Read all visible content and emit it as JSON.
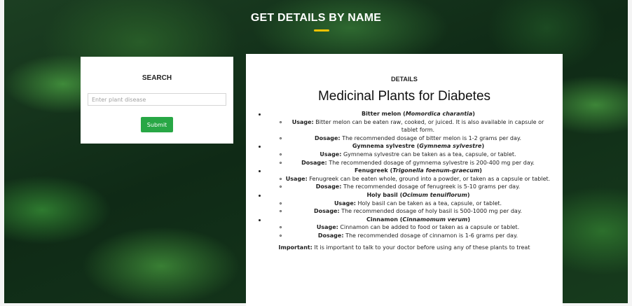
{
  "header": {
    "title": "GET DETAILS BY NAME",
    "accent_color": "#f2c200"
  },
  "search": {
    "heading": "SEARCH",
    "placeholder": "Enter plant disease",
    "value": "",
    "submit_label": "Submit",
    "button_color": "#28a745"
  },
  "details": {
    "heading": "DETAILS",
    "title": "Medicinal Plants for Diabetes",
    "plants": [
      {
        "name": "Bitter melon",
        "scientific": "Momordica charantia",
        "usage_label": "Usage:",
        "usage": "Bitter melon can be eaten raw, cooked, or juiced. It is also available in capsule or tablet form.",
        "dosage_label": "Dosage:",
        "dosage": "The recommended dosage of bitter melon is 1-2 grams per day."
      },
      {
        "name": "Gymnema sylvestre",
        "scientific": "Gymnema sylvestre",
        "usage_label": "Usage:",
        "usage": "Gymnema sylvestre can be taken as a tea, capsule, or tablet.",
        "dosage_label": "Dosage:",
        "dosage": "The recommended dosage of gymnema sylvestre is 200-400 mg per day."
      },
      {
        "name": "Fenugreek",
        "scientific": "Trigonella foenum-graecum",
        "usage_label": "Usage:",
        "usage": "Fenugreek can be eaten whole, ground into a powder, or taken as a capsule or tablet.",
        "dosage_label": "Dosage:",
        "dosage": "The recommended dosage of fenugreek is 5-10 grams per day."
      },
      {
        "name": "Holy basil",
        "scientific": "Ocimum tenuiflorum",
        "usage_label": "Usage:",
        "usage": "Holy basil can be taken as a tea, capsule, or tablet.",
        "dosage_label": "Dosage:",
        "dosage": "The recommended dosage of holy basil is 500-1000 mg per day."
      },
      {
        "name": "Cinnamon",
        "scientific": "Cinnamomum verum",
        "usage_label": "Usage:",
        "usage": "Cinnamon can be added to food or taken as a capsule or tablet.",
        "dosage_label": "Dosage:",
        "dosage": "The recommended dosage of cinnamon is 1-6 grams per day."
      }
    ],
    "note_label": "Important:",
    "note": "It is important to talk to your doctor before using any of these plants to treat"
  }
}
